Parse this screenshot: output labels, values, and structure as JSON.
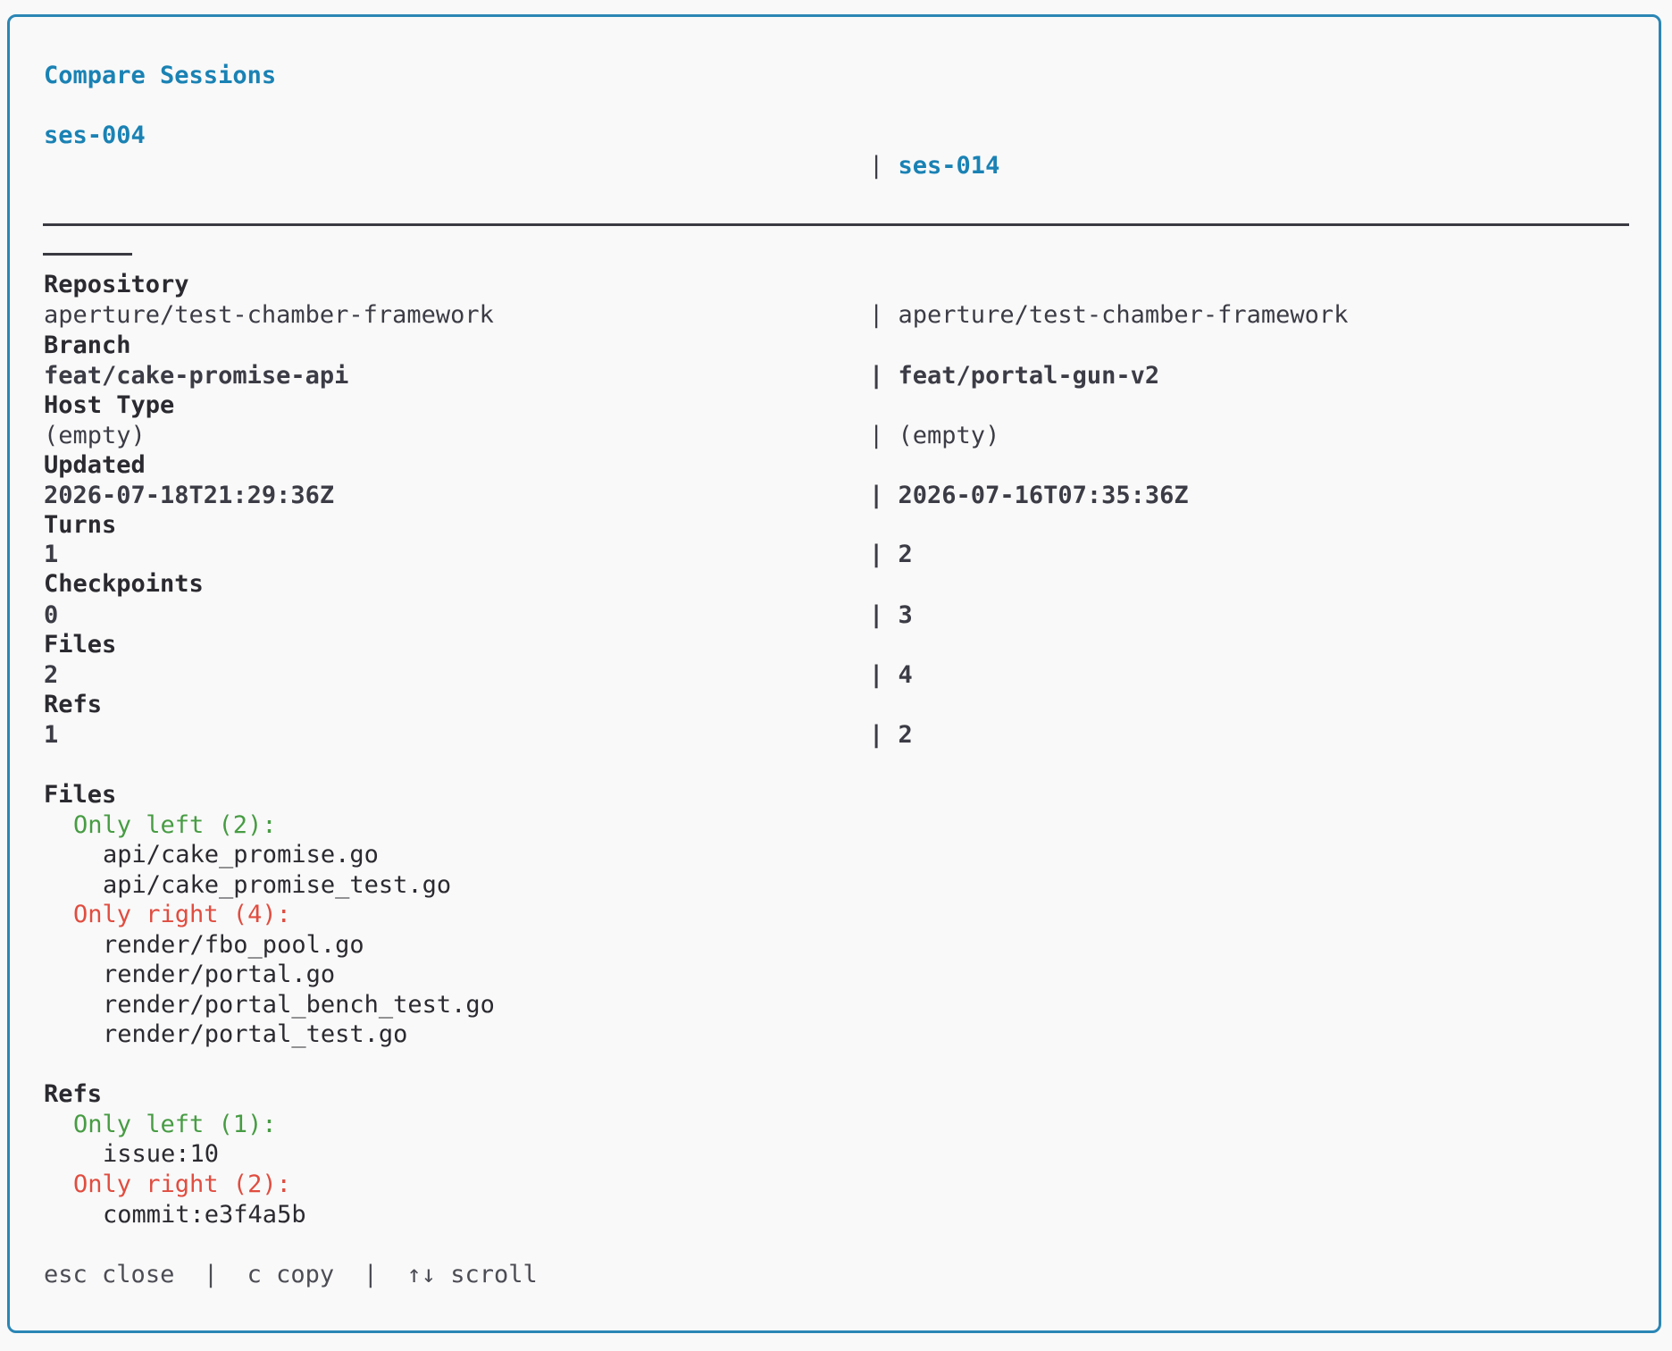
{
  "title": "Compare Sessions",
  "left_session": "ses-004",
  "right_session": "ses-014",
  "separator": "|",
  "fields": [
    {
      "label": "Repository",
      "left": "aperture/test-chamber-framework",
      "right": "aperture/test-chamber-framework"
    },
    {
      "label": "Branch",
      "left": "feat/cake-promise-api",
      "right": "feat/portal-gun-v2"
    },
    {
      "label": "Host Type",
      "left": "(empty)",
      "right": "(empty)"
    },
    {
      "label": "Updated",
      "left": "2026-07-18T21:29:36Z",
      "right": "2026-07-16T07:35:36Z"
    },
    {
      "label": "Turns",
      "left": "1",
      "right": "2"
    },
    {
      "label": "Checkpoints",
      "left": "0",
      "right": "3"
    },
    {
      "label": "Files",
      "left": "2",
      "right": "4"
    },
    {
      "label": "Refs",
      "left": "1",
      "right": "2"
    }
  ],
  "files": {
    "heading": "Files",
    "only_left_label": "Only left (2):",
    "only_left": [
      "api/cake_promise.go",
      "api/cake_promise_test.go"
    ],
    "only_right_label": "Only right (4):",
    "only_right": [
      "render/fbo_pool.go",
      "render/portal.go",
      "render/portal_bench_test.go",
      "render/portal_test.go"
    ]
  },
  "refs": {
    "heading": "Refs",
    "only_left_label": "Only left (1):",
    "only_left": [
      "issue:10"
    ],
    "only_right_label": "Only right (2):",
    "only_right": [
      "commit:e3f4a5b"
    ]
  },
  "footer": {
    "esc_key": "esc",
    "esc_action": "close",
    "copy_key": "c",
    "copy_action": "copy",
    "scroll_key": "↑↓",
    "scroll_action": "scroll",
    "divider": "|"
  }
}
